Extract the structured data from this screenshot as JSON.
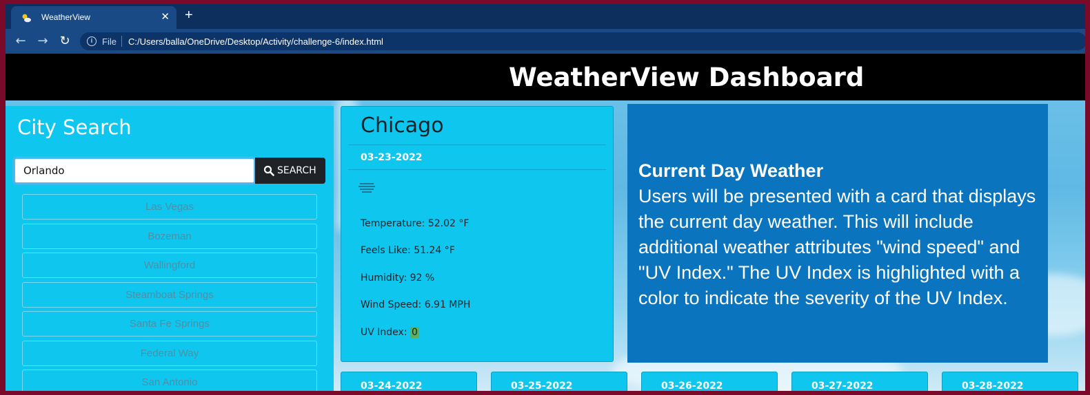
{
  "browser": {
    "tab_title": "WeatherView",
    "file_label": "File",
    "url": "C:/Users/balla/OneDrive/Desktop/Activity/challenge-6/index.html"
  },
  "header": {
    "title": "WeatherView Dashboard"
  },
  "sidebar": {
    "title": "City Search",
    "search_value": "Orlando",
    "search_button_label": "SEARCH",
    "history": [
      "Las Vegas",
      "Bozeman",
      "Wallingford",
      "Steamboat Springs",
      "Santa Fe Springs",
      "Federal Way",
      "San Antonio"
    ]
  },
  "current": {
    "city": "Chicago",
    "date": "03-23-2022",
    "icon": "fog-icon",
    "temperature_label": "Temperature: 52.02 °F",
    "feels_like_label": "Feels Like: 51.24 °F",
    "humidity_label": "Humidity: 92 %",
    "wind_label": "Wind Speed: 6.91 MPH",
    "uv_label": "UV Index: ",
    "uv_value": "0",
    "uv_color": "#5fb05a"
  },
  "info": {
    "heading": "Current Day Weather",
    "body": "Users will be presented with a card that displays the current day weather. This will include additional weather attributes \"wind speed\" and \"UV Index.\" The UV Index is highlighted with a color to indicate the severity of the UV Index."
  },
  "forecast": [
    {
      "date": "03-24-2022"
    },
    {
      "date": "03-25-2022"
    },
    {
      "date": "03-26-2022"
    },
    {
      "date": "03-27-2022"
    },
    {
      "date": "03-28-2022"
    }
  ],
  "colors": {
    "header": "#000000",
    "card": "#0fc6ee",
    "info_panel": "#0a74be"
  }
}
